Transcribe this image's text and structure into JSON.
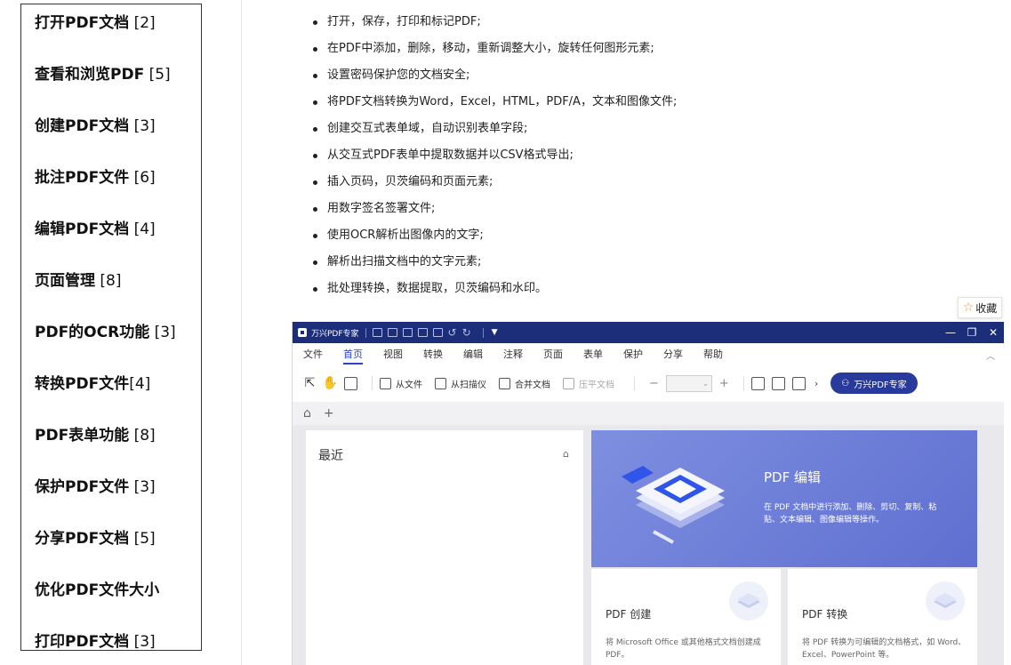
{
  "categories": [
    {
      "label": "打开PDF文档",
      "count": " [2]"
    },
    {
      "label": "查看和浏览PDF",
      "count": " [5]"
    },
    {
      "label": "创建PDF文档",
      "count": " [3]"
    },
    {
      "label": "批注PDF文件",
      "count": " [6]"
    },
    {
      "label": "编辑PDF文档",
      "count": " [4]"
    },
    {
      "label": "页面管理",
      "count": " [8]"
    },
    {
      "label": "PDF的OCR功能",
      "count": " [3]"
    },
    {
      "label": "转换PDF文件",
      "count": "[4]"
    },
    {
      "label": "PDF表单功能",
      "count": " [8]"
    },
    {
      "label": "保护PDF文件",
      "count": " [3]"
    },
    {
      "label": "分享PDF文档",
      "count": " [5]"
    },
    {
      "label": "优化PDF文件大小",
      "count": ""
    },
    {
      "label": "打印PDF文档",
      "count": " [3]"
    }
  ],
  "features": [
    "打开，保存，打印和标记PDF;",
    "在PDF中添加，删除，移动，重新调整大小，旋转任何图形元素;",
    "设置密码保护您的文档安全;",
    "将PDF文档转换为Word，Excel，HTML，PDF/A，文本和图像文件;",
    "创建交互式表单域，自动识别表单字段;",
    "从交互式PDF表单中提取数据并以CSV格式导出;",
    "插入页码，贝茨编码和页面元素;",
    "用数字签名签署文件;",
    "使用OCR解析出图像内的文字;",
    "解析出扫描文档中的文字元素;",
    "批处理转换，数据提取，贝茨编码和水印。"
  ],
  "favorite": {
    "label": "收藏",
    "icon": "star-icon"
  },
  "app": {
    "title": "万兴PDF专家",
    "menus": [
      "文件",
      "首页",
      "视图",
      "转换",
      "编辑",
      "注释",
      "页面",
      "表单",
      "保护",
      "分享",
      "帮助"
    ],
    "active_menu": "首页",
    "toolbar": {
      "from_file": "从文件",
      "from_scanner": "从扫描仪",
      "merge": "合并文档",
      "flatten": "压平文档",
      "zoom_minus": "−",
      "zoom_plus": "+",
      "brand_button": "万兴PDF专家"
    },
    "recent_title": "最近",
    "hero": {
      "title": "PDF 编辑",
      "desc": "在 PDF 文档中进行添加、删除、剪切、复制、粘贴、文本编辑、图像编辑等操作。"
    },
    "cards": [
      {
        "title": "PDF 创建",
        "desc": "将 Microsoft Office 或其他格式文档创建成 PDF。"
      },
      {
        "title": "PDF 转换",
        "desc": "将 PDF 转换为可编辑的文档格式，如 Word、Excel、PowerPoint 等。"
      }
    ],
    "colors": {
      "titlebar": "#1c2d79",
      "accent": "#2b44c4",
      "hero": "#6b7bd8"
    }
  }
}
